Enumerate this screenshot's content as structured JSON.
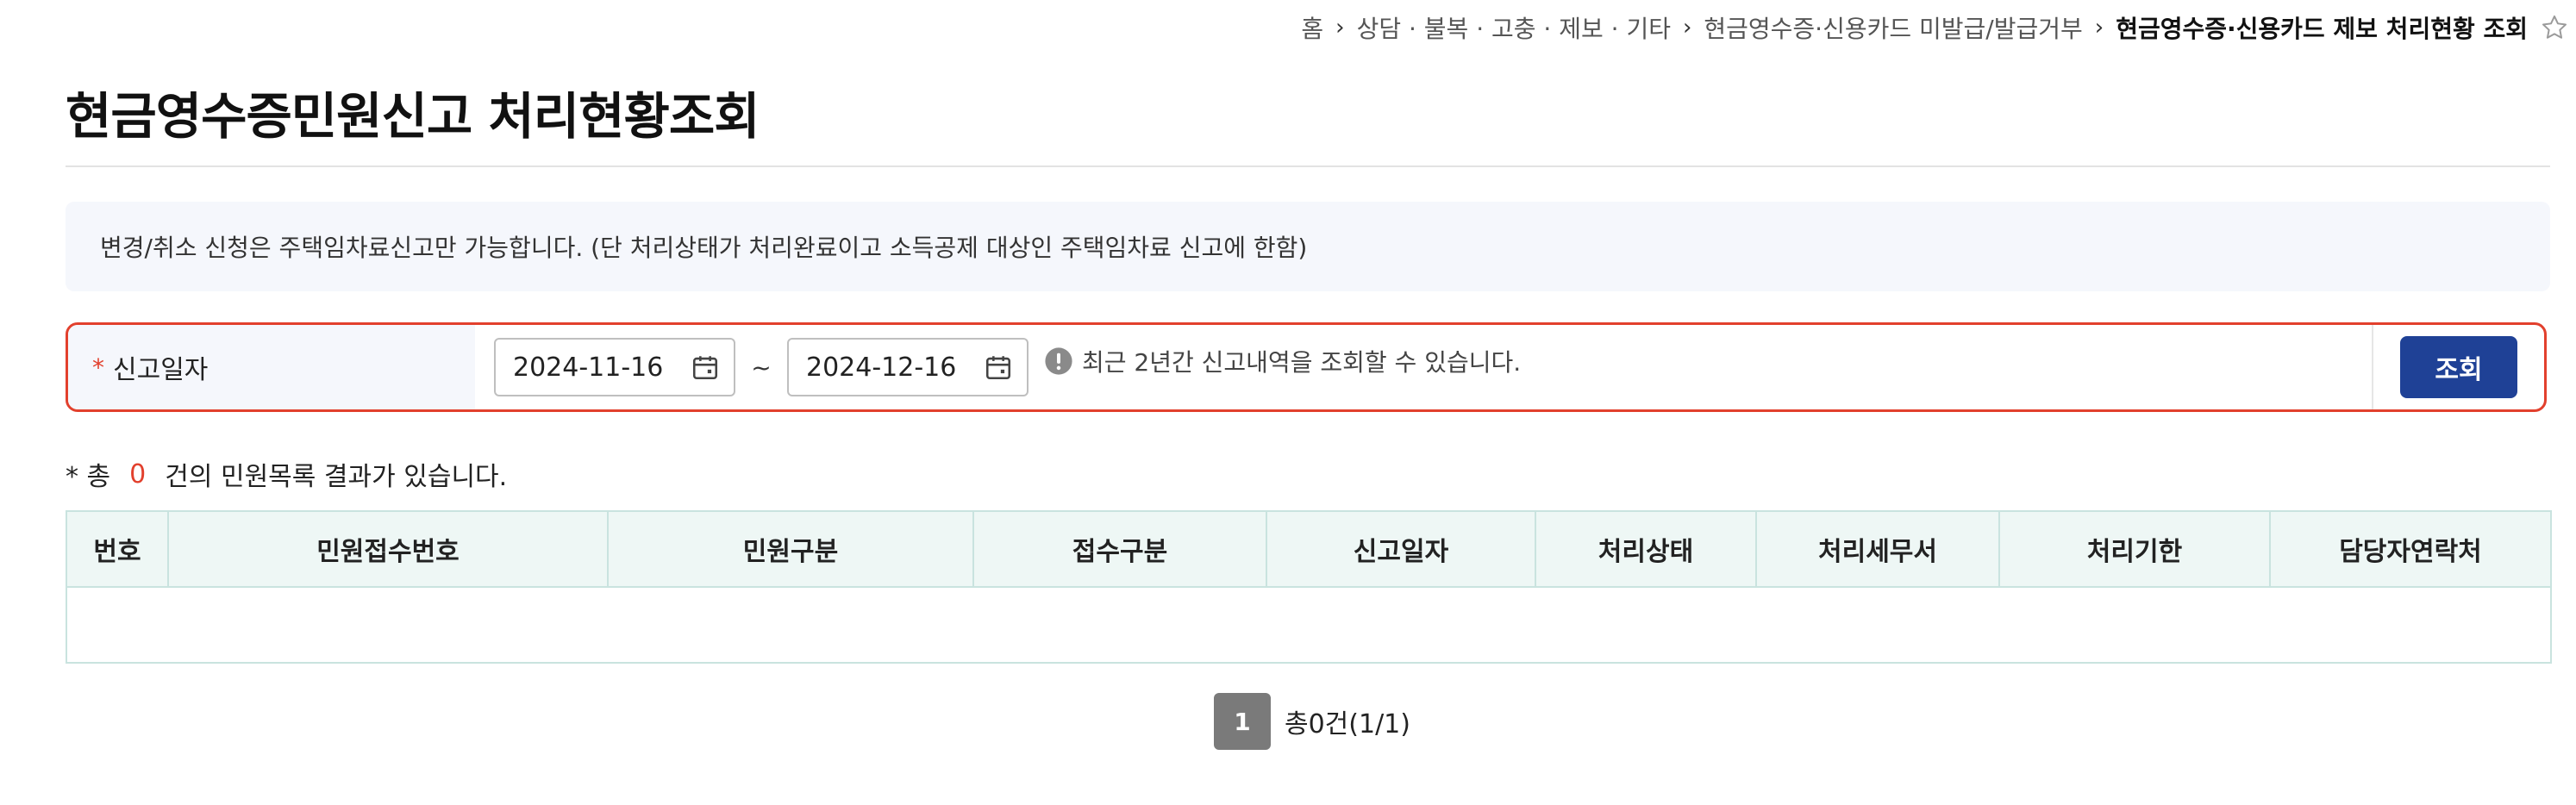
{
  "breadcrumb": {
    "items": [
      "홈",
      "상담 · 불복 · 고충 · 제보 · 기타",
      "현금영수증·신용카드 미발급/발급거부",
      "현금영수증·신용카드 제보 처리현황 조회"
    ]
  },
  "page": {
    "title": "현금영수증민원신고 처리현황조회"
  },
  "notice": {
    "text": "변경/취소 신청은 주택임차료신고만 가능합니다. (단 처리상태가 처리완료이고 소득공제 대상인 주택임차료 신고에 한함)"
  },
  "search": {
    "required_mark": "*",
    "label": "신고일자",
    "start_date": "2024-11-16",
    "separator": "~",
    "end_date": "2024-12-16",
    "hint": "최근 2년간 신고내역을 조회할 수 있습니다.",
    "button_label": "조회"
  },
  "results": {
    "prefix": "* 총",
    "count": "0",
    "suffix": "건의 민원목록 결과가 있습니다."
  },
  "table": {
    "columns": [
      "번호",
      "민원접수번호",
      "민원구분",
      "접수구분",
      "신고일자",
      "처리상태",
      "처리세무서",
      "처리기한",
      "담당자연락처"
    ],
    "rows": []
  },
  "pagination": {
    "current_page": "1",
    "summary": "총0건(1/1)"
  },
  "colors": {
    "accent_red": "#e2402d",
    "primary_button": "#1f4196",
    "table_header_bg": "#eef7f5"
  }
}
